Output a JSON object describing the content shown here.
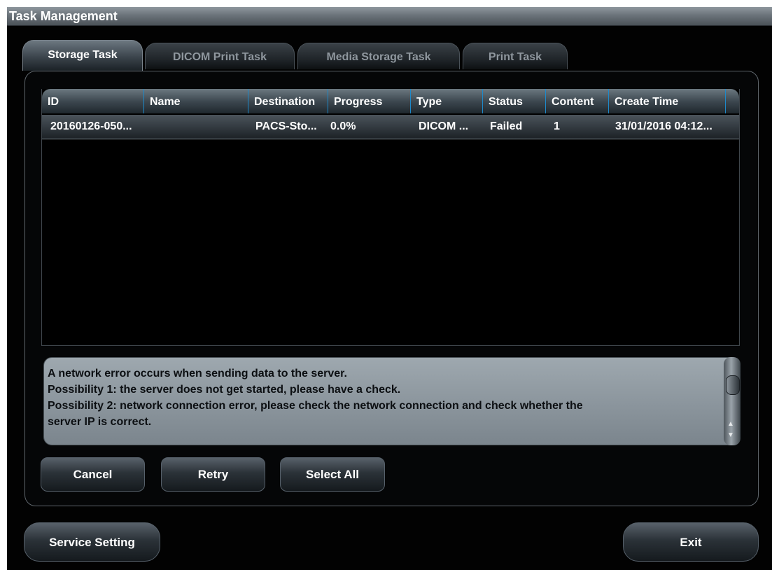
{
  "window": {
    "title": "Task Management"
  },
  "tabs": [
    {
      "label": "Storage Task",
      "active": true
    },
    {
      "label": "DICOM Print Task",
      "active": false
    },
    {
      "label": "Media Storage Task",
      "active": false
    },
    {
      "label": "Print Task",
      "active": false
    }
  ],
  "table": {
    "columns": [
      "ID",
      "Name",
      "Destination",
      "Progress",
      "Type",
      "Status",
      "Content",
      "Create Time"
    ],
    "rows": [
      {
        "id": "20160126-050...",
        "name": "",
        "destination": "PACS-Sto...",
        "progress": "0.0%",
        "type": "DICOM ...",
        "status": "Failed",
        "content": "1",
        "create_time": "31/01/2016 04:12..."
      }
    ]
  },
  "message": {
    "lines": [
      "A network error occurs when sending data to the server.",
      "Possibility 1: the server does not get started, please have a check.",
      "Possibility 2: network connection error, please check the network connection and check whether the",
      "server IP is correct."
    ]
  },
  "buttons": {
    "cancel": "Cancel",
    "retry": "Retry",
    "select_all": "Select All",
    "service_setting": "Service Setting",
    "exit": "Exit"
  },
  "colors": {
    "column_divider": "#1e89c9",
    "message_background": "#8d979e",
    "window_background": "#020202"
  }
}
